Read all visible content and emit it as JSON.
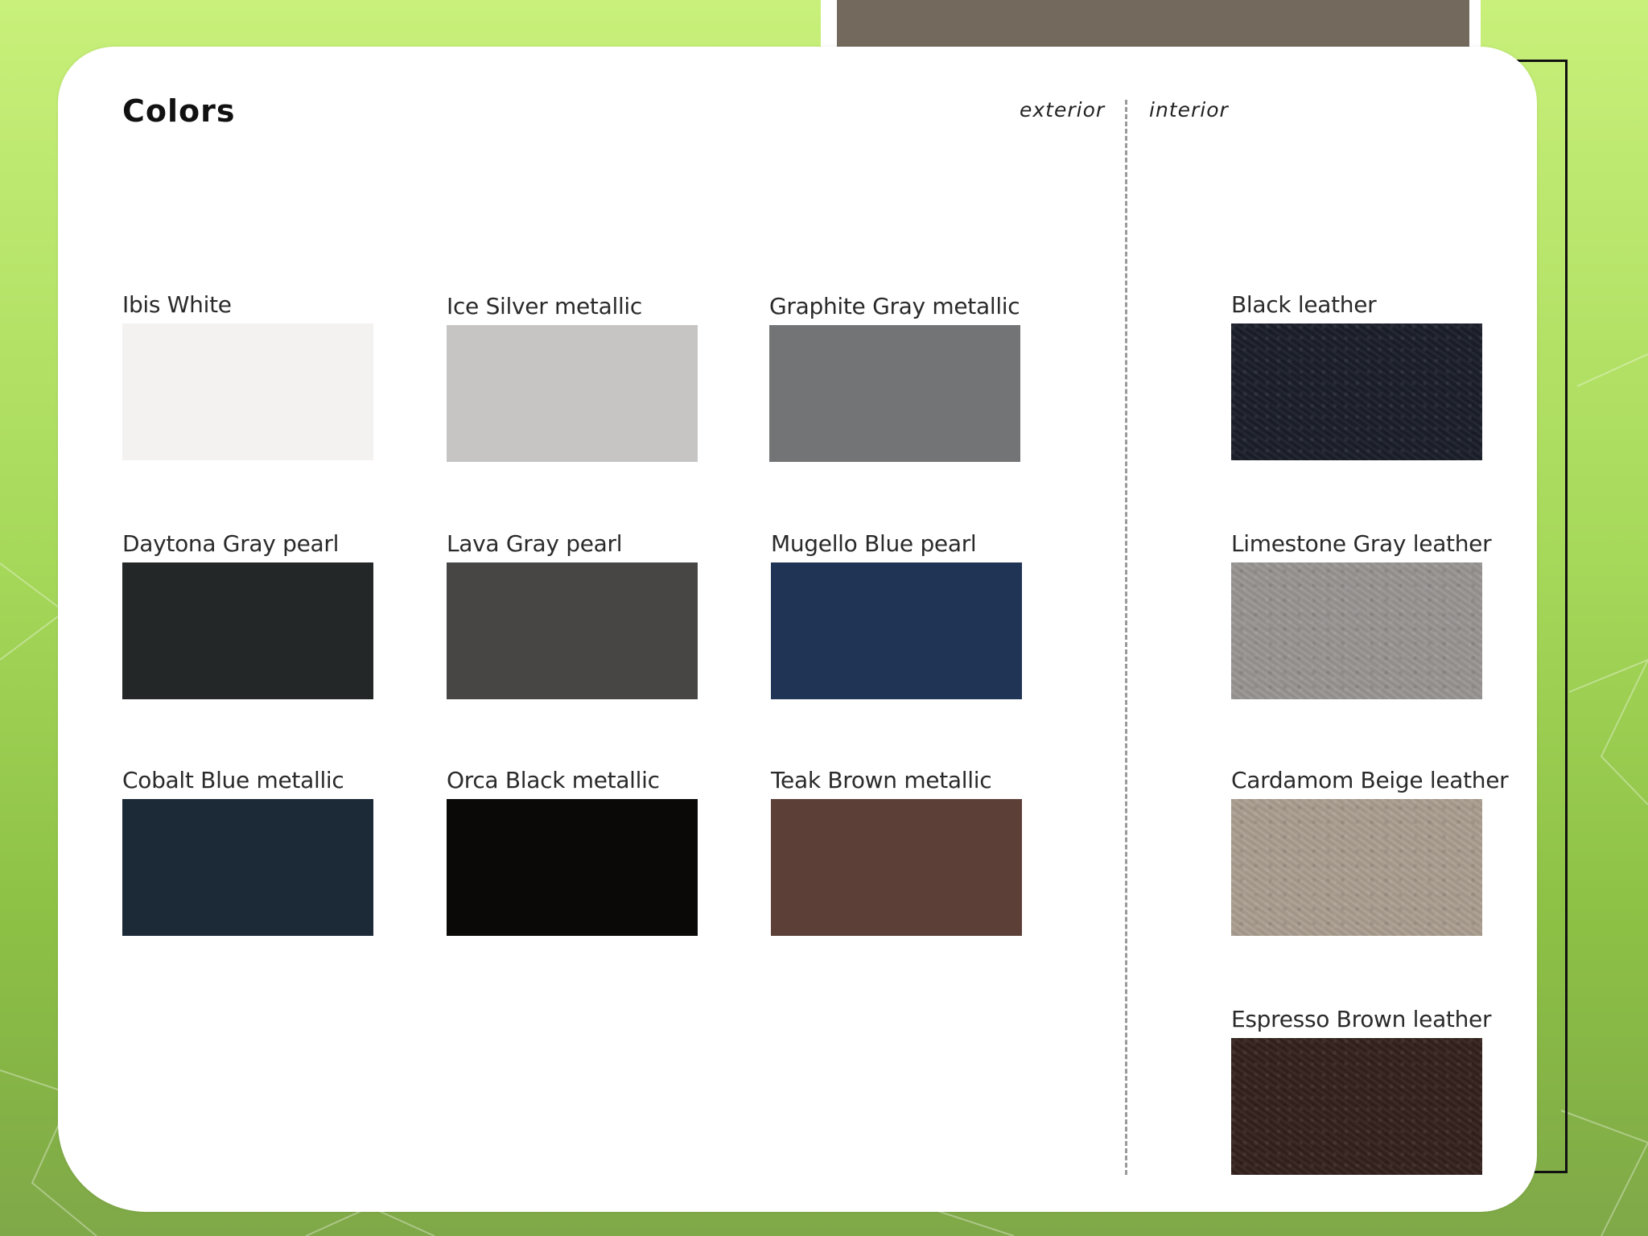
{
  "title": "Colors",
  "labels": {
    "exterior": "exterior",
    "interior": "interior"
  },
  "exterior": [
    {
      "name": "Ibis White",
      "color": "#f3f2f0"
    },
    {
      "name": "Ice Silver metallic",
      "color": "#c6c5c4"
    },
    {
      "name": "Graphite Gray metallic",
      "color": "#737475"
    },
    {
      "name": "Daytona Gray pearl",
      "color": "#232728"
    },
    {
      "name": "Lava Gray pearl",
      "color": "#484645"
    },
    {
      "name": "Mugello Blue pearl",
      "color": "#203456"
    },
    {
      "name": "Cobalt Blue metallic",
      "color": "#1c2937"
    },
    {
      "name": "Orca Black metallic",
      "color": "#0a0908"
    },
    {
      "name": "Teak Brown metallic",
      "color": "#5c4037"
    }
  ],
  "interior": [
    {
      "name": "Black leather",
      "color": "#1b1f2a"
    },
    {
      "name": "Limestone Gray leather",
      "color": "#999593"
    },
    {
      "name": "Cardamom Beige leather",
      "color": "#aa9e90"
    },
    {
      "name": "Espresso Brown leather",
      "color": "#34221d"
    }
  ]
}
